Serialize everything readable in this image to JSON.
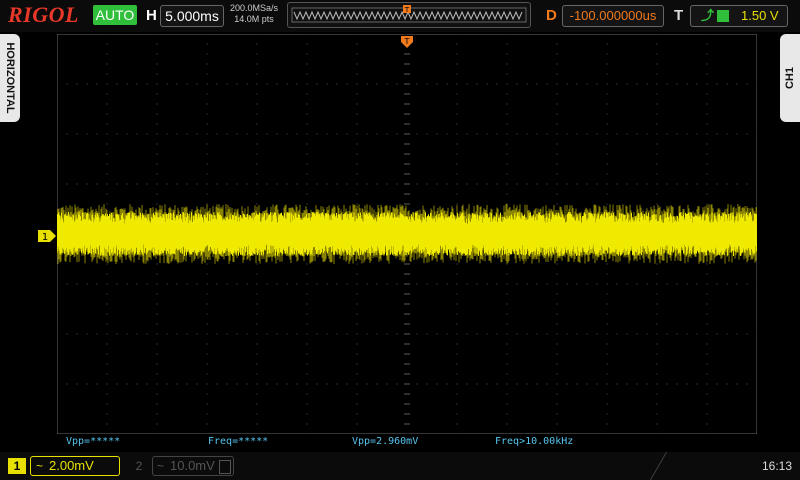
{
  "brand": "RIGOL",
  "header": {
    "trigger_mode": "AUTO",
    "horizontal_label": "H",
    "timebase": "5.000ms",
    "sample_rate": "200.0MSa/s",
    "memory_depth": "14.0M pts",
    "delay_label": "D",
    "delay": "-100.000000us",
    "trigger_label": "T",
    "trigger_edge": "rising-edge-icon",
    "trigger_source": "square-icon",
    "trigger_level": "1.50 V"
  },
  "side_tabs": {
    "left": "HORIZONTAL",
    "right": "CH1"
  },
  "ch1_marker": "1",
  "measurements": [
    {
      "label": "Vpp=*****"
    },
    {
      "label": "Freq=*****"
    },
    {
      "label": "Vpp=2.960mV"
    },
    {
      "label": "Freq>10.00kHz"
    }
  ],
  "channels": [
    {
      "number": "1",
      "coupling": "~",
      "scale": "2.00mV",
      "active": true,
      "color": "#e8e000"
    },
    {
      "number": "2",
      "coupling": "~",
      "scale": "10.0mV",
      "active": false,
      "color": "#555555"
    }
  ],
  "clock": "16:13",
  "colors": {
    "trace": "#f0ea00",
    "grid": "#5a5a5a",
    "trigger_marker": "#f07a1c",
    "measure_text": "#58c6f0"
  }
}
